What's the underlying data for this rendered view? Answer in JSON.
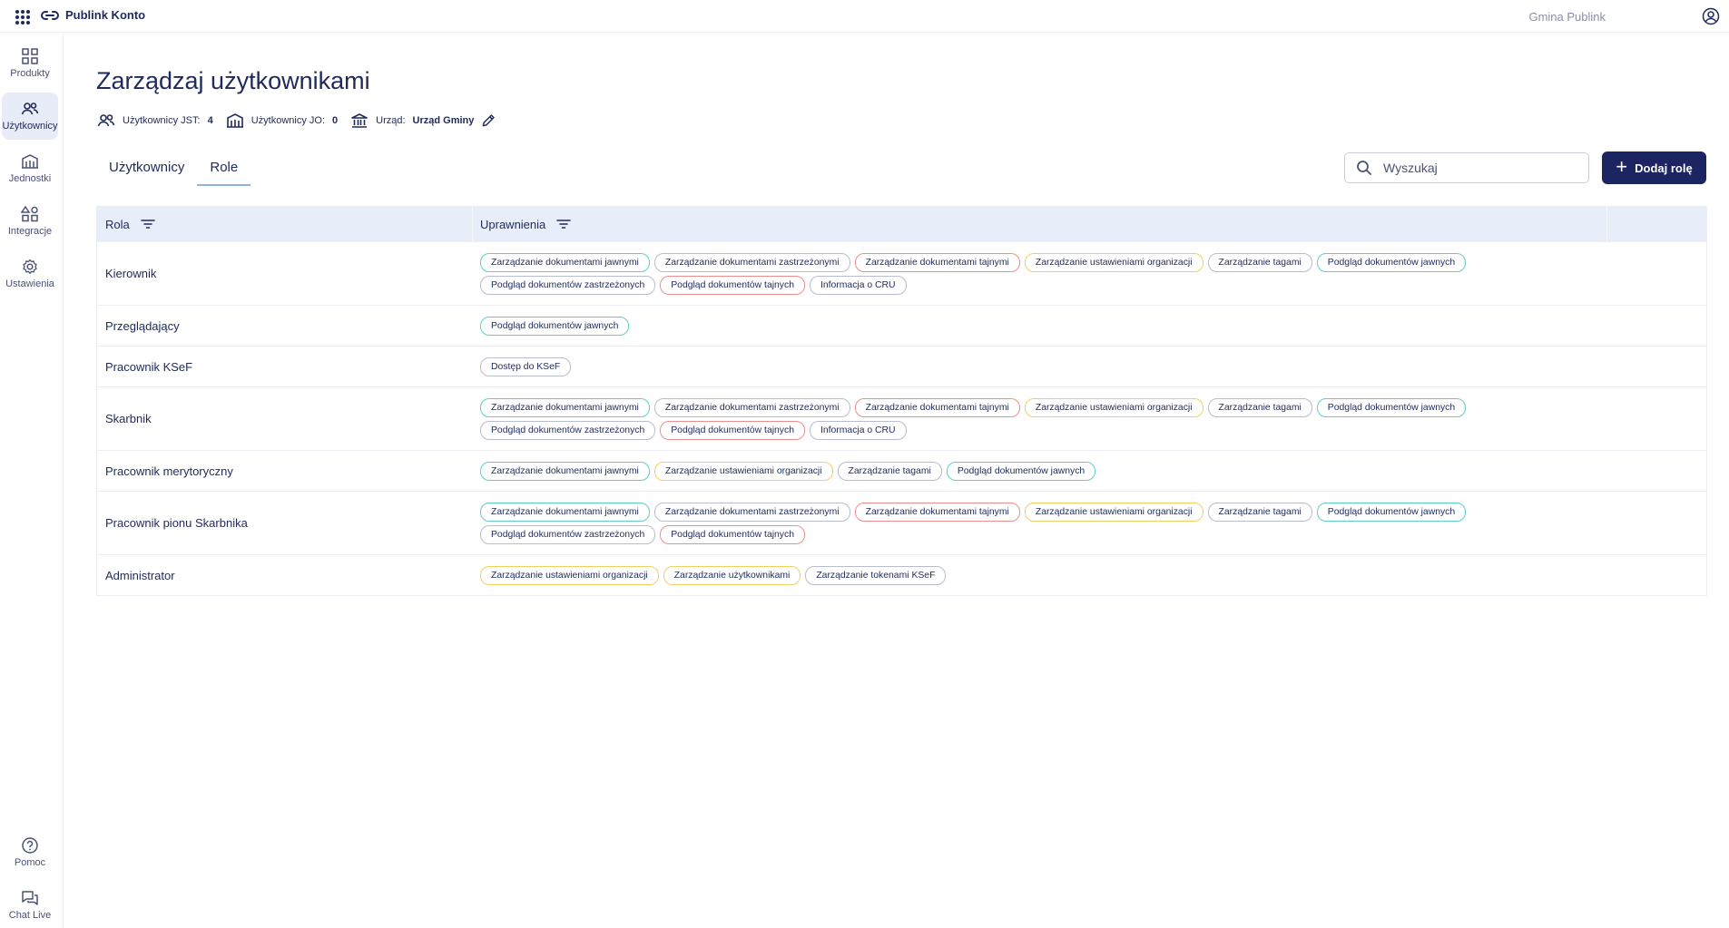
{
  "topbar": {
    "brand": "Publink Konto",
    "org_name": "Gmina Publink"
  },
  "sidebar": {
    "items": [
      {
        "label": "Produkty",
        "icon": "grid-icon"
      },
      {
        "label": "Użytkownicy",
        "icon": "users-icon",
        "active": true
      },
      {
        "label": "Jednostki",
        "icon": "buildings-icon"
      },
      {
        "label": "Integracje",
        "icon": "shapes-icon"
      },
      {
        "label": "Ustawienia",
        "icon": "gear-icon"
      }
    ],
    "bottom": [
      {
        "label": "Pomoc",
        "icon": "help-icon"
      },
      {
        "label": "Chat Live",
        "icon": "chat-icon"
      }
    ]
  },
  "page": {
    "title": "Zarządzaj użytkownikami",
    "stats": {
      "jst_label": "Użytkownicy JST:",
      "jst_value": "4",
      "jo_label": "Użytkownicy JO:",
      "jo_value": "0",
      "office_label": "Urząd:",
      "office_value": "Urząd Gminy"
    },
    "tabs": [
      "Użytkownicy",
      "Role"
    ],
    "active_tab": "Role",
    "search_placeholder": "Wyszukaj",
    "add_button": "Dodaj rolę"
  },
  "table": {
    "columns": [
      "Rola",
      "Uprawnienia"
    ],
    "rows": [
      {
        "role": "Kierownik",
        "perms": [
          {
            "t": "Zarządzanie dokumentami jawnymi",
            "c": "teal"
          },
          {
            "t": "Zarządzanie dokumentami zastrzeżonymi",
            "c": "gray"
          },
          {
            "t": "Zarządzanie dokumentami tajnymi",
            "c": "red"
          },
          {
            "t": "Zarządzanie ustawieniami organizacji",
            "c": "yellow"
          },
          {
            "t": "Zarządzanie tagami",
            "c": "gray"
          },
          {
            "t": "Podgląd dokumentów jawnych",
            "c": "teal"
          },
          {
            "t": "Podgląd dokumentów zastrzeżonych",
            "c": "gray"
          },
          {
            "t": "Podgląd dokumentów tajnych",
            "c": "red"
          },
          {
            "t": "Informacja o CRU",
            "c": "gray"
          }
        ]
      },
      {
        "role": "Przeglądający",
        "perms": [
          {
            "t": "Podgląd dokumentów jawnych",
            "c": "teal"
          }
        ]
      },
      {
        "role": "Pracownik KSeF",
        "perms": [
          {
            "t": "Dostęp do KSeF",
            "c": "gray"
          }
        ]
      },
      {
        "role": "Skarbnik",
        "perms": [
          {
            "t": "Zarządzanie dokumentami jawnymi",
            "c": "teal"
          },
          {
            "t": "Zarządzanie dokumentami zastrzeżonymi",
            "c": "gray"
          },
          {
            "t": "Zarządzanie dokumentami tajnymi",
            "c": "red"
          },
          {
            "t": "Zarządzanie ustawieniami organizacji",
            "c": "yellow"
          },
          {
            "t": "Zarządzanie tagami",
            "c": "gray"
          },
          {
            "t": "Podgląd dokumentów jawnych",
            "c": "teal"
          },
          {
            "t": "Podgląd dokumentów zastrzeżonych",
            "c": "gray"
          },
          {
            "t": "Podgląd dokumentów tajnych",
            "c": "red"
          },
          {
            "t": "Informacja o CRU",
            "c": "gray"
          }
        ]
      },
      {
        "role": "Pracownik merytoryczny",
        "perms": [
          {
            "t": "Zarządzanie dokumentami jawnymi",
            "c": "teal"
          },
          {
            "t": "Zarządzanie ustawieniami organizacji",
            "c": "yellow"
          },
          {
            "t": "Zarządzanie tagami",
            "c": "gray"
          },
          {
            "t": "Podgląd dokumentów jawnych",
            "c": "teal"
          }
        ]
      },
      {
        "role": "Pracownik pionu Skarbnika",
        "perms": [
          {
            "t": "Zarządzanie dokumentami jawnymi",
            "c": "teal"
          },
          {
            "t": "Zarządzanie dokumentami zastrzeżonymi",
            "c": "gray"
          },
          {
            "t": "Zarządzanie dokumentami tajnymi",
            "c": "red"
          },
          {
            "t": "Zarządzanie ustawieniami organizacji",
            "c": "yellow"
          },
          {
            "t": "Zarządzanie tagami",
            "c": "gray"
          },
          {
            "t": "Podgląd dokumentów jawnych",
            "c": "teal"
          },
          {
            "t": "Podgląd dokumentów zastrzeżonych",
            "c": "gray"
          },
          {
            "t": "Podgląd dokumentów tajnych",
            "c": "red"
          }
        ]
      },
      {
        "role": "Administrator",
        "perms": [
          {
            "t": "Zarządzanie ustawieniami organizacji",
            "c": "yellow"
          },
          {
            "t": "Zarządzanie użytkownikami",
            "c": "yellow"
          },
          {
            "t": "Zarządzanie tokenami KSeF",
            "c": "gray"
          }
        ]
      }
    ]
  },
  "colors": {
    "primary": "#1c2461",
    "chip_teal": "#5ecfc7",
    "chip_red": "#ec8e8e",
    "chip_yellow": "#f3cf62",
    "chip_gray": "#b8bccb",
    "header_bg": "#e8eef9"
  }
}
